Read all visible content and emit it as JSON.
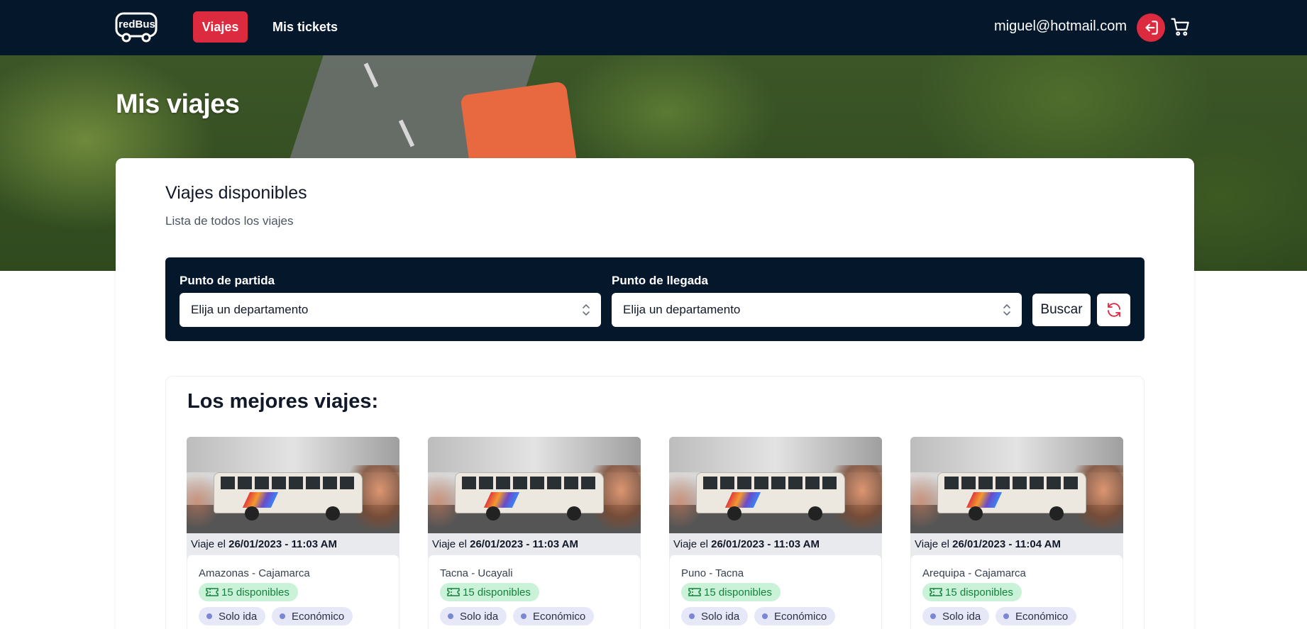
{
  "nav": {
    "logo_text": "redBus",
    "items": [
      {
        "label": "Viajes",
        "active": true
      },
      {
        "label": "Mis tickets",
        "active": false
      }
    ],
    "user_email": "miguel@hotmail.com",
    "icons": {
      "logout": "logout-icon",
      "cart": "cart-icon"
    },
    "accent_color": "#dc2a3e",
    "bar_color": "#04172b"
  },
  "hero": {
    "title": "Mis viajes"
  },
  "section": {
    "title": "Viajes disponibles",
    "subtitle": "Lista de todos los viajes"
  },
  "filters": {
    "departure_label": "Punto de partida",
    "departure_value": "Elija un departamento",
    "arrival_label": "Punto de llegada",
    "arrival_value": "Elija un departamento",
    "search_label": "Buscar",
    "refresh_icon": "refresh-icon"
  },
  "best_trips": {
    "title": "Los mejores viajes:",
    "cards": [
      {
        "date_prefix": "Viaje el",
        "date": "26/01/2023 - 11:03 AM",
        "route": "Amazonas - Cajamarca",
        "availability": "15 disponibles",
        "tags": [
          "Solo ida",
          "Económico"
        ]
      },
      {
        "date_prefix": "Viaje el",
        "date": "26/01/2023 - 11:03 AM",
        "route": "Tacna - Ucayali",
        "availability": "15 disponibles",
        "tags": [
          "Solo ida",
          "Económico"
        ]
      },
      {
        "date_prefix": "Viaje el",
        "date": "26/01/2023 - 11:03 AM",
        "route": "Puno - Tacna",
        "availability": "15 disponibles",
        "tags": [
          "Solo ida",
          "Económico"
        ]
      },
      {
        "date_prefix": "Viaje el",
        "date": "26/01/2023 - 11:04 AM",
        "route": "Arequipa - Cajamarca",
        "availability": "15 disponibles",
        "tags": [
          "Solo ida",
          "Económico"
        ]
      }
    ]
  }
}
